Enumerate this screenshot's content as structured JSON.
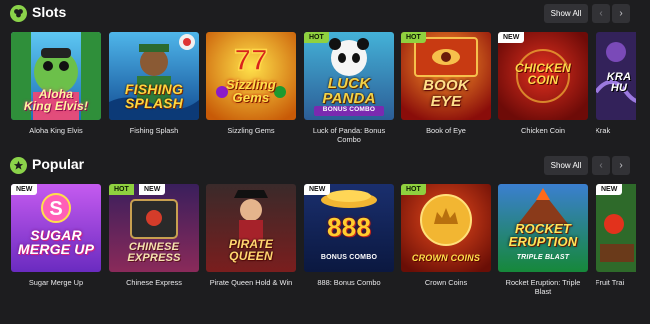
{
  "slots": {
    "title": "Slots",
    "icon": "clover-icon",
    "show_all": "Show All",
    "prev": "‹",
    "next": "›",
    "games": [
      {
        "name": "Aloha King Elvis",
        "art_title": "Aloha\nKing Elvis!",
        "badges": []
      },
      {
        "name": "Fishing Splash",
        "art_title": "FISHING\nSPLASH",
        "badges": []
      },
      {
        "name": "Sizzling Gems",
        "art_title": "Sizzling\nGems",
        "badges": []
      },
      {
        "name": "Luck of Panda: Bonus Combo",
        "art_title": "LUCK\nPANDA",
        "art_sub": "BONUS COMBO",
        "badges": [
          "HOT"
        ]
      },
      {
        "name": "Book of Eye",
        "art_title": "BOOK\nEYE",
        "badges": [
          "HOT"
        ]
      },
      {
        "name": "Chicken Coin",
        "art_title": "CHICKEN\nCOIN",
        "badges": [
          "NEW"
        ]
      },
      {
        "name": "Krak",
        "art_title": "KRA\nHU",
        "badges": []
      }
    ]
  },
  "popular": {
    "title": "Popular",
    "icon": "star-icon",
    "show_all": "Show All",
    "prev": "‹",
    "next": "›",
    "games": [
      {
        "name": "Sugar Merge Up",
        "art_title": "SUGAR\nMERGE UP",
        "badges": [
          "NEW"
        ]
      },
      {
        "name": "Chinese Express",
        "art_title": "CHINESE\nEXPRESS",
        "badges": [
          "HOT",
          "NEW"
        ]
      },
      {
        "name": "Pirate Queen Hold & Win",
        "art_title": "PIRATE\nQUEEN",
        "badges": []
      },
      {
        "name": "888: Bonus Combo",
        "art_title": "888",
        "art_sub": "BONUS COMBO",
        "badges": [
          "NEW"
        ]
      },
      {
        "name": "Crown Coins",
        "art_title": "CROWN COINS",
        "badges": [
          "HOT"
        ]
      },
      {
        "name": "Rocket Eruption: Triple Blast",
        "art_title": "ROCKET\nERUPTION",
        "art_sub": "TRIPLE BLAST",
        "badges": []
      },
      {
        "name": "Fruit Trai",
        "art_title": "",
        "badges": [
          "NEW"
        ]
      }
    ]
  },
  "colors": {
    "background": "#1d1d1f",
    "button": "#323236",
    "hot_badge": "#8fd13f",
    "new_badge": "#ffffff",
    "accent_green": "#8bd34a"
  }
}
